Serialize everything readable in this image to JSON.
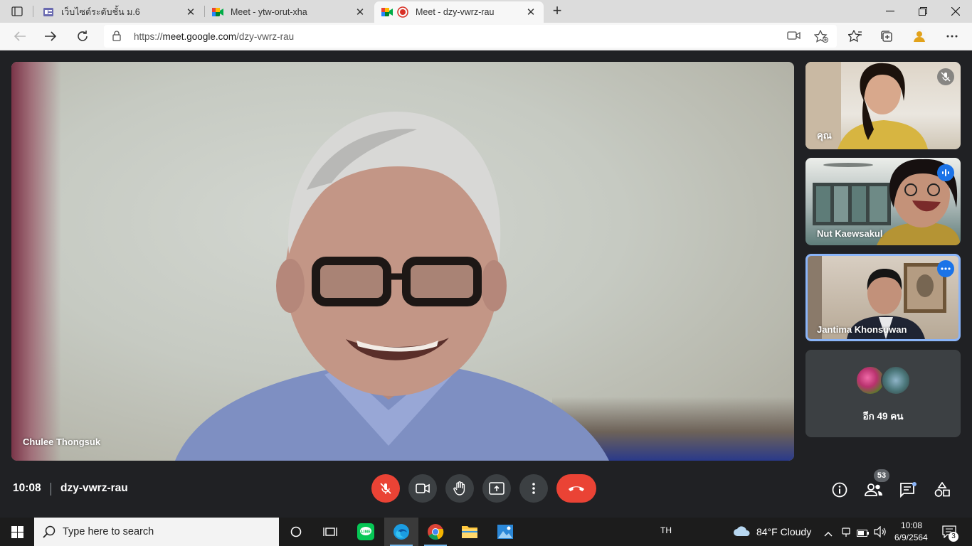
{
  "browser": {
    "tabs": [
      {
        "title": "เว็บไซต์ระดับชั้น ม.6",
        "active": false
      },
      {
        "title": "Meet - ytw-orut-xha",
        "active": false
      },
      {
        "title": "Meet - dzy-vwrz-rau",
        "active": true
      }
    ],
    "url_prefix": "https://",
    "url_host": "meet.google.com",
    "url_path": "/dzy-vwrz-rau"
  },
  "meet": {
    "main_speaker": "Chulee Thongsuk",
    "tiles": [
      {
        "name": "คุณ",
        "status_icon": "mic-off-icon"
      },
      {
        "name": "Nut Kaewsakul",
        "status_icon": "speaking-icon"
      },
      {
        "name": "Jantima Khonsuwan",
        "status_icon": "more-options-icon",
        "active": true
      }
    ],
    "others_label": "อีก 49 คน",
    "time": "10:08",
    "meeting_code": "dzy-vwrz-rau",
    "participant_count": "53"
  },
  "taskbar": {
    "search_placeholder": "Type here to search",
    "language": "TH",
    "weather": "84°F  Cloudy",
    "clock_time": "10:08",
    "clock_date": "6/9/2564",
    "notification_count": "3"
  },
  "colors": {
    "accent_blue": "#1a73e8",
    "end_call_red": "#ea4335",
    "meet_bg": "#202124"
  }
}
